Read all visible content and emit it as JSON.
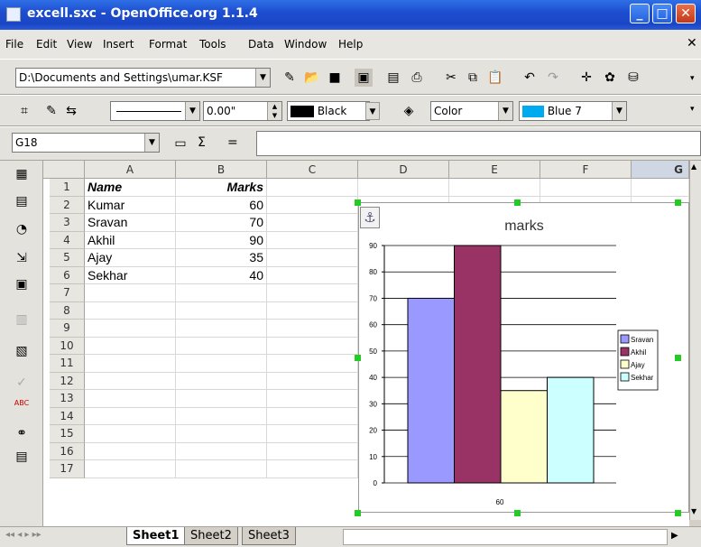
{
  "window": {
    "title": "excell.sxc - OpenOffice.org 1.1.4"
  },
  "menu": [
    "File",
    "Edit",
    "View",
    "Insert",
    "Format",
    "Tools",
    "Data",
    "Window",
    "Help"
  ],
  "toolbar1": {
    "path": "D:\\Documents and Settings\\umar.KSF"
  },
  "toolbar2": {
    "line_width": "0.00\"",
    "line_color": "Black",
    "fill_type": "Color",
    "fill_color": "Blue 7"
  },
  "formula": {
    "cell_ref": "G18",
    "sigma": "Σ",
    "equals": "="
  },
  "columns": [
    "A",
    "B",
    "C",
    "D",
    "E",
    "F",
    "G"
  ],
  "rows": [
    "1",
    "2",
    "3",
    "4",
    "5",
    "6",
    "7",
    "8",
    "9",
    "10",
    "11",
    "12",
    "13",
    "14",
    "15",
    "16",
    "17"
  ],
  "table": {
    "header": [
      "Name",
      "Marks"
    ],
    "data": [
      [
        "Kumar",
        "60"
      ],
      [
        "Sravan",
        "70"
      ],
      [
        "Akhil",
        "90"
      ],
      [
        "Ajay",
        "35"
      ],
      [
        "Sekhar",
        "40"
      ]
    ]
  },
  "sheets": [
    "Sheet1",
    "Sheet2",
    "Sheet3"
  ],
  "colors": {
    "s1": "#9999ff",
    "s2": "#993366",
    "s3": "#ffffcc",
    "s4": "#ccffff"
  },
  "chart_data": {
    "type": "bar",
    "title": "marks",
    "xlabel": "60",
    "ylim": [
      0,
      90
    ],
    "yticks": [
      "0",
      "10",
      "20",
      "30",
      "40",
      "50",
      "60",
      "70",
      "80",
      "90"
    ],
    "series": [
      {
        "name": "Sravan",
        "values": [
          70
        ]
      },
      {
        "name": "Akhil",
        "values": [
          90
        ]
      },
      {
        "name": "Ajay",
        "values": [
          35
        ]
      },
      {
        "name": "Sekhar",
        "values": [
          40
        ]
      }
    ],
    "legend": [
      "Sravan",
      "Akhil",
      "Ajay",
      "Sekhar"
    ],
    "legend_position": "right"
  }
}
